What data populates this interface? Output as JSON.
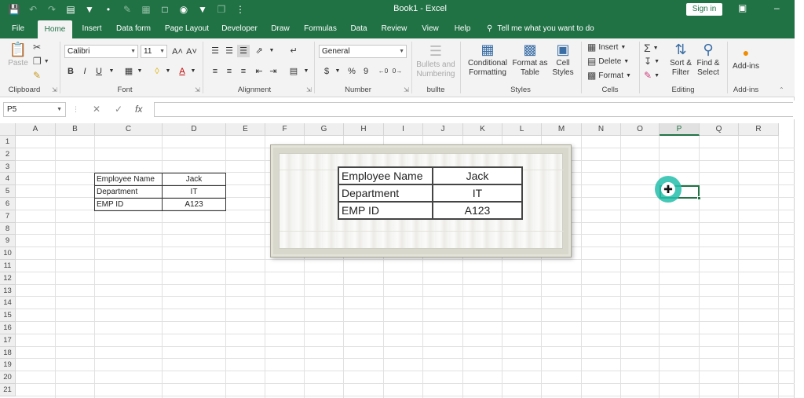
{
  "titlebar": {
    "document_title": "Book1  -  Excel",
    "signin_label": "Sign in",
    "qat_icons": [
      "save-icon",
      "undo-icon",
      "redo-icon",
      "form-icon",
      "filter-icon",
      "bullet-icon",
      "paint-icon",
      "table-icon",
      "comment-icon",
      "camera-icon",
      "filter2-icon",
      "more-icon"
    ]
  },
  "tabs": [
    {
      "label": "File"
    },
    {
      "label": "Home",
      "active": true
    },
    {
      "label": "Insert"
    },
    {
      "label": "Data form"
    },
    {
      "label": "Page Layout"
    },
    {
      "label": "Developer"
    },
    {
      "label": "Draw"
    },
    {
      "label": "Formulas"
    },
    {
      "label": "Data"
    },
    {
      "label": "Review"
    },
    {
      "label": "View"
    },
    {
      "label": "Help"
    }
  ],
  "tell_me": "Tell me what you want to do",
  "ribbon": {
    "clipboard": {
      "paste": "Paste",
      "label": "Clipboard"
    },
    "font": {
      "name": "Calibri",
      "size": "11",
      "label": "Font",
      "bold": "B",
      "italic": "I",
      "underline": "U",
      "grow": "A˄",
      "shrink": "A˅",
      "font_color_letter": "A"
    },
    "alignment": {
      "label": "Alignment"
    },
    "number": {
      "format": "General",
      "currency": "$",
      "percent": "%",
      "comma": "9",
      "label": "Number"
    },
    "bullets": {
      "button": "Bullets and Numbering",
      "label": "bullte"
    },
    "styles": {
      "conditional": "Conditional Formatting",
      "format_table": "Format as Table",
      "cell_styles": "Cell Styles",
      "label": "Styles"
    },
    "cells": {
      "insert": "Insert",
      "delete": "Delete",
      "format": "Format",
      "label": "Cells"
    },
    "editing": {
      "sort": "Sort & Filter",
      "find": "Find & Select",
      "label": "Editing"
    },
    "addins": {
      "button": "Add-ins",
      "label": "Add-ins"
    }
  },
  "formula_bar": {
    "name_box": "P5",
    "cancel": "✕",
    "enter": "✓",
    "fx": "fx",
    "value": ""
  },
  "columns": [
    "A",
    "B",
    "C",
    "D",
    "E",
    "F",
    "G",
    "H",
    "I",
    "J",
    "K",
    "L",
    "M",
    "N",
    "O",
    "P",
    "Q",
    "R"
  ],
  "selected_column": "P",
  "rows": [
    "1",
    "2",
    "3",
    "4",
    "5",
    "6",
    "7",
    "8",
    "9",
    "10",
    "11",
    "12",
    "13",
    "14",
    "15",
    "16",
    "17",
    "18",
    "19",
    "20",
    "21"
  ],
  "sheet_table": [
    {
      "label": "Employee Name",
      "value": "Jack"
    },
    {
      "label": "Department",
      "value": "IT"
    },
    {
      "label": "EMP ID",
      "value": "A123"
    }
  ],
  "picture_table": [
    {
      "label": "Employee Name",
      "value": "Jack"
    },
    {
      "label": "Department",
      "value": "IT"
    },
    {
      "label": "EMP ID",
      "value": "A123"
    }
  ],
  "colors": {
    "excel_green": "#207245",
    "selection_green": "#217346",
    "cursor_ring": "#24beaa"
  }
}
